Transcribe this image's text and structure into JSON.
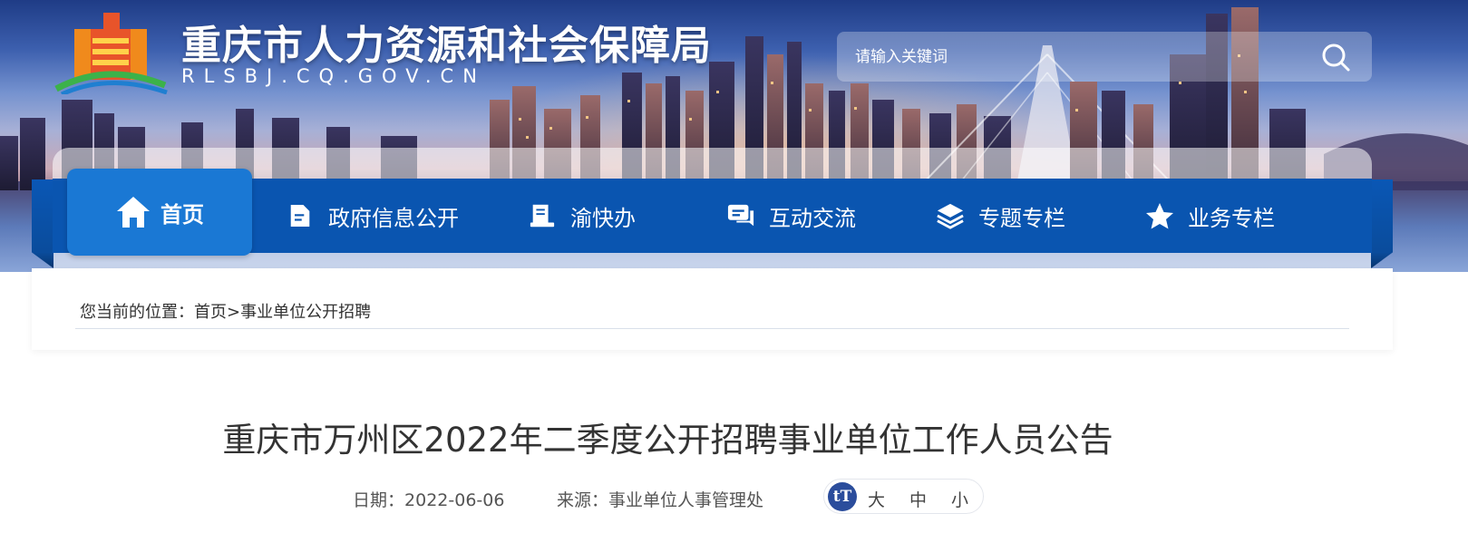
{
  "header": {
    "site_title": "重庆市人力资源和社会保障局",
    "site_domain": "RLSBJ.CQ.GOV.CN",
    "search_placeholder": "请输入关键词"
  },
  "nav": {
    "items": [
      {
        "label": "首页",
        "icon": "home-icon",
        "active": true
      },
      {
        "label": "政府信息公开",
        "icon": "document-icon"
      },
      {
        "label": "渝快办",
        "icon": "service-desk-icon"
      },
      {
        "label": "互动交流",
        "icon": "chat-icon"
      },
      {
        "label": "专题专栏",
        "icon": "layers-icon"
      },
      {
        "label": "业务专栏",
        "icon": "star-icon"
      }
    ]
  },
  "breadcrumb": {
    "prefix": "您当前的位置：",
    "home": "首页",
    "separator": ">",
    "current": "事业单位公开招聘"
  },
  "article": {
    "title": "重庆市万州区2022年二季度公开招聘事业单位工作人员公告",
    "date_label": "日期：",
    "date": "2022-06-06",
    "source_label": "来源：",
    "source": "事业单位人事管理处"
  },
  "font_size": {
    "icon": "tT",
    "options": [
      "大",
      "中",
      "小"
    ]
  },
  "colors": {
    "nav_bg": "#0a55b0",
    "nav_active": "#1a78d4",
    "font_icon_bg": "#2b4d9c"
  }
}
